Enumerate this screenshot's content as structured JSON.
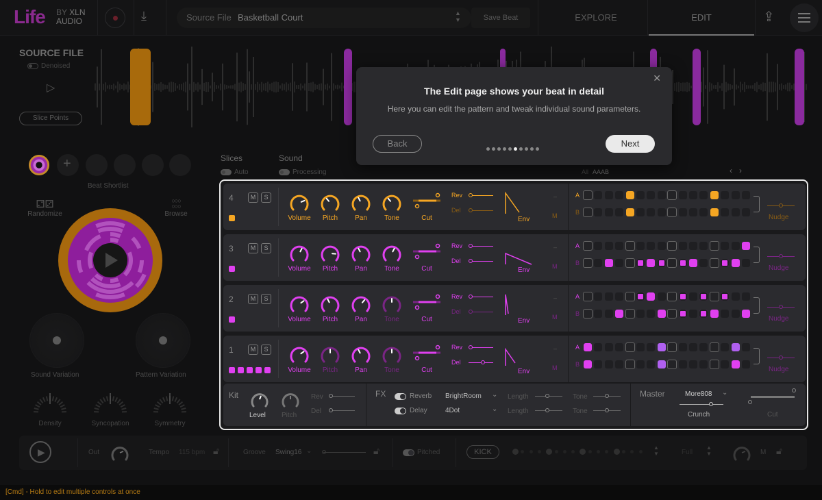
{
  "app": {
    "logo_main": "Life",
    "logo_by": "BY",
    "logo_brand_1": "XLN",
    "logo_brand_2": "AUDIO"
  },
  "topbar": {
    "source_label": "Source File",
    "source_value": "Basketball Court",
    "save_beat": "Save Beat",
    "tabs": [
      {
        "label": "EXPLORE",
        "active": false
      },
      {
        "label": "EDIT",
        "active": true
      }
    ]
  },
  "source_file": {
    "title": "SOURCE FILE",
    "denoised_label": "Denoised",
    "slice_points_label": "Slice Points",
    "slice_colors": [
      "#a86a0c",
      "#8a2a9e",
      "#8a2a9e",
      "#8a2a9e",
      "#8a2a9e",
      "#8a2a9e"
    ]
  },
  "left_panel": {
    "beat_shortlist_label": "Beat Shortlist",
    "randomize_label": "Randomize",
    "browse_label": "Browse",
    "sound_variation_label": "Sound Variation",
    "pattern_variation_label": "Pattern Variation",
    "density_label": "Density",
    "syncopation_label": "Syncopation",
    "symmetry_label": "Symmetry"
  },
  "edit": {
    "slices_label": "Slices",
    "slices_auto_label": "Auto",
    "sound_label": "Sound",
    "sound_processing_label": "Processing",
    "pattern_all_label": "All",
    "pattern_value": "AAAB",
    "tracks": [
      {
        "number": "4",
        "color": "#f5a623",
        "dim_color": "#8a5d14",
        "mute": "M",
        "solo": "S",
        "squares": 1,
        "knobs": [
          {
            "label": "Volume",
            "value": 0.75,
            "active": true
          },
          {
            "label": "Pitch",
            "value": 0.35,
            "active": true
          },
          {
            "label": "Pan",
            "value": 0.4,
            "active": true
          },
          {
            "label": "Tone",
            "value": 0.35,
            "active": true
          }
        ],
        "cut_label": "Cut",
        "rev_label": "Rev",
        "del_label": "Del",
        "rev_active": true,
        "del_active": false,
        "env_label": "Env",
        "m_label": "M",
        "row_a_label": "A",
        "row_b_label": "B",
        "row_a": [
          0,
          0,
          0,
          0,
          2,
          0,
          0,
          0,
          0,
          0,
          0,
          0,
          2,
          0,
          0,
          0
        ],
        "row_b": [
          0,
          0,
          0,
          0,
          2,
          0,
          0,
          0,
          0,
          0,
          0,
          0,
          2,
          0,
          0,
          0
        ],
        "nudge_label": "Nudge"
      },
      {
        "number": "3",
        "color": "#e040f0",
        "dim_color": "#7a2585",
        "mute": "M",
        "solo": "S",
        "squares": 1,
        "knobs": [
          {
            "label": "Volume",
            "value": 0.6,
            "active": true
          },
          {
            "label": "Pitch",
            "value": 0.85,
            "active": true
          },
          {
            "label": "Pan",
            "value": 0.4,
            "active": true
          },
          {
            "label": "Tone",
            "value": 0.6,
            "active": true
          }
        ],
        "cut_label": "Cut",
        "rev_label": "Rev",
        "del_label": "Del",
        "rev_active": true,
        "del_active": true,
        "env_label": "Env",
        "m_label": "M",
        "row_a_label": "A",
        "row_b_label": "B",
        "row_a": [
          0,
          0,
          0,
          0,
          0,
          0,
          0,
          0,
          0,
          0,
          0,
          0,
          0,
          0,
          0,
          2
        ],
        "row_b": [
          0,
          0,
          2,
          0,
          0,
          1,
          2,
          1,
          0,
          1,
          2,
          0,
          0,
          1,
          2,
          0
        ],
        "nudge_label": "Nudge"
      },
      {
        "number": "2",
        "color": "#e040f0",
        "dim_color": "#7a2585",
        "mute": "M",
        "solo": "S",
        "squares": 1,
        "knobs": [
          {
            "label": "Volume",
            "value": 0.7,
            "active": true
          },
          {
            "label": "Pitch",
            "value": 0.4,
            "active": true
          },
          {
            "label": "Pan",
            "value": 0.65,
            "active": true
          },
          {
            "label": "Tone",
            "value": 0.5,
            "active": false
          }
        ],
        "cut_label": "Cut",
        "rev_label": "Rev",
        "del_label": "Del",
        "rev_active": true,
        "del_active": false,
        "env_label": "Env",
        "m_label": "M",
        "row_a_label": "A",
        "row_b_label": "B",
        "row_a": [
          0,
          0,
          0,
          0,
          0,
          1,
          2,
          0,
          0,
          1,
          0,
          1,
          0,
          1,
          0,
          0
        ],
        "row_b": [
          0,
          0,
          0,
          2,
          0,
          0,
          0,
          2,
          0,
          1,
          0,
          1,
          2,
          0,
          0,
          2
        ],
        "nudge_label": "Nudge"
      },
      {
        "number": "1",
        "color": "#e040f0",
        "dim_color": "#7a2585",
        "mute": "M",
        "solo": "S",
        "squares": 5,
        "knobs": [
          {
            "label": "Volume",
            "value": 0.7,
            "active": true
          },
          {
            "label": "Pitch",
            "value": 0.5,
            "active": false
          },
          {
            "label": "Pan",
            "value": 0.4,
            "active": true
          },
          {
            "label": "Tone",
            "value": 0.5,
            "active": false
          }
        ],
        "cut_label": "Cut",
        "rev_label": "Rev",
        "del_label": "Del",
        "rev_active": true,
        "del_active": true,
        "env_label": "Env",
        "m_label": "M",
        "row_a_label": "A",
        "row_b_label": "B",
        "row_a": [
          2,
          0,
          0,
          0,
          0,
          0,
          0,
          3,
          0,
          0,
          0,
          0,
          0,
          0,
          3,
          0
        ],
        "row_b": [
          2,
          0,
          0,
          0,
          0,
          0,
          0,
          3,
          0,
          0,
          0,
          0,
          0,
          0,
          2,
          0
        ],
        "nudge_label": "Nudge"
      }
    ],
    "kit": {
      "title": "Kit",
      "level_label": "Level",
      "pitch_label": "Pitch",
      "rev_label": "Rev",
      "del_label": "Del"
    },
    "fx": {
      "title": "FX",
      "reverb_label": "Reverb",
      "reverb_preset": "BrightRoom",
      "delay_label": "Delay",
      "delay_preset": "4Dot",
      "length_label": "Length",
      "tone_label": "Tone"
    },
    "master": {
      "title": "Master",
      "preset": "More808",
      "crunch_label": "Crunch",
      "cut_label": "Cut"
    }
  },
  "transport": {
    "out_label": "Out",
    "tempo_label": "Tempo",
    "tempo_value": "115 bpm",
    "groove_label": "Groove",
    "groove_value": "Swing16",
    "pitched_label": "Pitched",
    "kick_label": "KICK",
    "full_label": "Full",
    "m_label": "M"
  },
  "status": {
    "hint": "[Cmd] - Hold to edit multiple controls at once"
  },
  "modal": {
    "title": "The Edit page shows your beat in detail",
    "body": "Here you can edit the pattern and tweak individual sound parameters.",
    "back": "Back",
    "next": "Next",
    "total_steps": 10,
    "current_step": 6
  }
}
